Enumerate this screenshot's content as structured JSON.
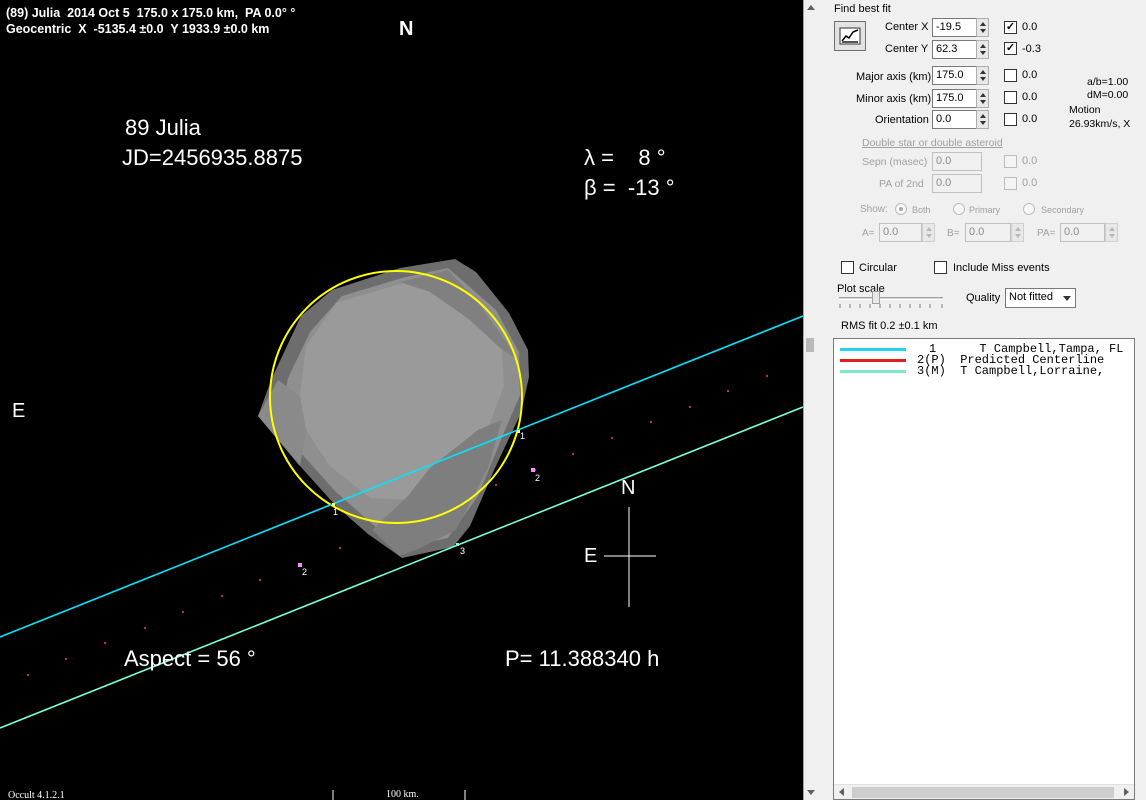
{
  "plot": {
    "header_line1": "(89) Julia  2014 Oct 5  175.0 x 175.0 km,  PA 0.0° °",
    "header_line2": "Geocentric  X  -5135.4 ±0.0  Y 1933.9 ±0.0 km",
    "north_top": "N",
    "east_left": "E",
    "object_name": "89 Julia",
    "julian_date": "JD=2456935.8875",
    "lambda": "λ =    8 °",
    "beta": "β =  -13 °",
    "aspect": "Aspect = 56 °",
    "period": "P= 11.388340 h",
    "compass_north": "N",
    "compass_east": "E",
    "chord_labels": [
      "1",
      "1",
      "2",
      "2",
      "3"
    ],
    "footer_version": "Occult 4.1.2.1",
    "footer_scale": "100 km."
  },
  "panel": {
    "find_best_fit": "Find best fit",
    "center_x": {
      "label": "Center X",
      "value": "-19.5",
      "checked": true,
      "fit": "0.0"
    },
    "center_y": {
      "label": "Center Y",
      "value": "62.3",
      "checked": true,
      "fit": "-0.3"
    },
    "major_axis": {
      "label": "Major axis (km)",
      "value": "175.0",
      "checked": false,
      "fit": "0.0"
    },
    "minor_axis": {
      "label": "Minor axis (km)",
      "value": "175.0",
      "checked": false,
      "fit": "0.0"
    },
    "orientation": {
      "label": "Orientation",
      "value": "0.0",
      "checked": false,
      "fit": "0.0"
    },
    "ab_ratio": "a/b=1.00",
    "dm": "dM=0.00",
    "motion_label": "Motion",
    "motion_value": "26.93km/s, X",
    "double_link": "Double star  or  double asteroid",
    "sepn": {
      "label": "Sepn (masec)",
      "value": "0.0",
      "fit": "0.0"
    },
    "pa2": {
      "label": "PA of 2nd",
      "value": "0.0",
      "fit": "0.0"
    },
    "show_label": "Show:",
    "show_options": [
      "Both",
      "Primary",
      "Secondary"
    ],
    "a_label": "A=",
    "a_value": "0.0",
    "b_label": "B=",
    "b_value": "0.0",
    "pa_label": "PA=",
    "pa_value": "0.0",
    "circular": "Circular",
    "include_miss": "Include Miss events",
    "plot_scale": "Plot scale",
    "quality_label": "Quality",
    "quality_value": "Not fitted",
    "rms_fit": "RMS fit  0.2 ±0.1 km"
  },
  "legend": [
    {
      "text": "1      T Campbell,Tampa, FL",
      "color": "#22d3ee"
    },
    {
      "text": "2(P)  Predicted Centerline",
      "color": "#e02020"
    },
    {
      "text": "3(M)  T Campbell,Lorraine,",
      "color": "#7fe8c8"
    }
  ]
}
